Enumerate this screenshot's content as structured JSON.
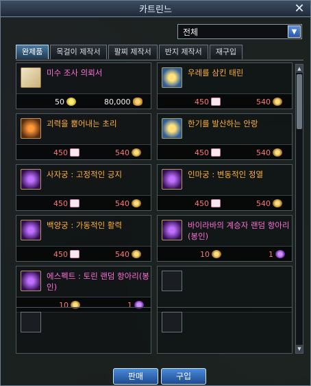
{
  "window": {
    "title": "카트린느"
  },
  "filter": {
    "selected": "전체"
  },
  "tabs": [
    {
      "label": "완제품"
    },
    {
      "label": "목걸이 제작서"
    },
    {
      "label": "팔찌 제작서"
    },
    {
      "label": "반지 제작서"
    },
    {
      "label": "재구입"
    }
  ],
  "items": [
    {
      "name": "미수 조사 의뢰서",
      "name_color": "pink",
      "cost1": "50",
      "cost1_icon": "gold",
      "cost2": "80,000",
      "cost2_icon": "coin",
      "icon": "scroll-icon"
    },
    {
      "name": "우레를 삼킨 태린",
      "name_color": "orange",
      "cost1": "450",
      "cost1_icon": "envelope",
      "cost2": "540",
      "cost2_icon": "gear",
      "icon": "gold-bracelet-icon"
    },
    {
      "name": "괴력을 뿜어내는 초리",
      "name_color": "orange",
      "cost1": "450",
      "cost1_icon": "envelope",
      "cost2": "540",
      "cost2_icon": "gear",
      "icon": "orange-necklace-icon"
    },
    {
      "name": "한기를 발산하는 안랑",
      "name_color": "orange",
      "cost1": "450",
      "cost1_icon": "envelope",
      "cost2": "540",
      "cost2_icon": "gear",
      "icon": "gold-bracelet-icon"
    },
    {
      "name": "사자궁 : 고정적인 긍지",
      "name_color": "orange",
      "cost1": "450",
      "cost1_icon": "envelope",
      "cost2": "540",
      "cost2_icon": "gear",
      "icon": "purple-ring-icon"
    },
    {
      "name": "인마궁 : 변동적인 정열",
      "name_color": "orange",
      "cost1": "450",
      "cost1_icon": "envelope",
      "cost2": "540",
      "cost2_icon": "gear",
      "icon": "purple-ring-icon"
    },
    {
      "name": "백양궁 : 가동적인 활력",
      "name_color": "orange",
      "cost1": "450",
      "cost1_icon": "envelope",
      "cost2": "540",
      "cost2_icon": "gear",
      "icon": "purple-ring-icon"
    },
    {
      "name": "바이라바의 계승자 랜덤 항아리(봉인)",
      "name_color": "pink",
      "cost1": "10",
      "cost1_icon": "gear",
      "cost2": "1",
      "cost2_icon": "purple",
      "icon": "purple-jar-icon"
    },
    {
      "name": "에스펙트 : 토린 랜덤 항아리(봉인)",
      "name_color": "pink",
      "cost1": "10",
      "cost1_icon": "gear",
      "cost2": "1",
      "cost2_icon": "purple",
      "icon": "purple-jar-icon"
    }
  ],
  "buttons": {
    "sell": "판매",
    "buy": "구입"
  },
  "close_glyph": "✕",
  "dropdown_glyph": "▼",
  "scroll_up": "▲",
  "scroll_down": "▼"
}
